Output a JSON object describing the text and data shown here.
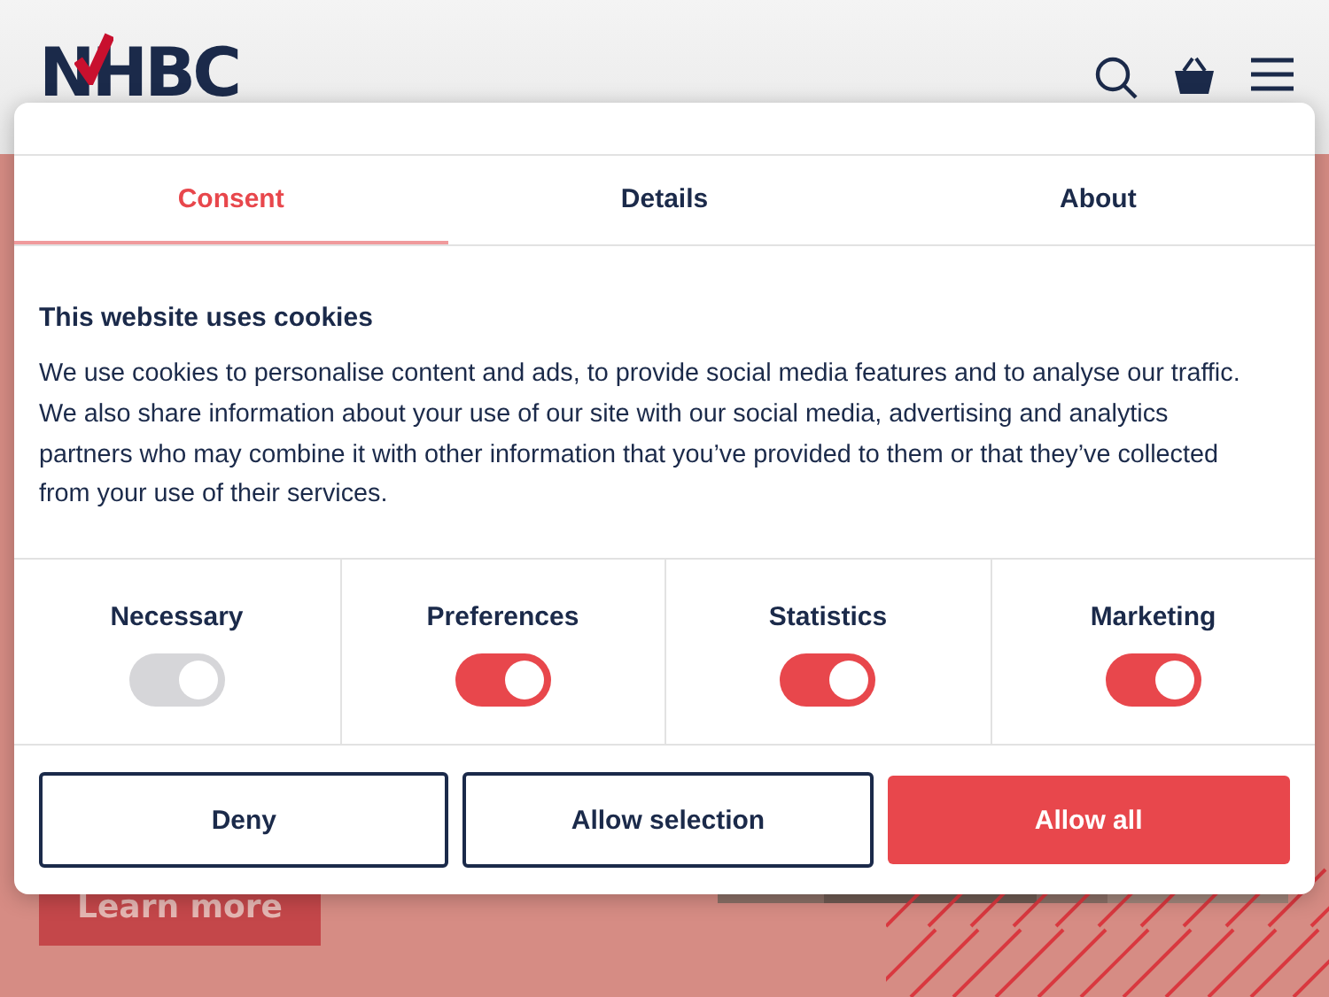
{
  "header": {
    "logo": "NHBC"
  },
  "hero": {
    "button": "Learn more"
  },
  "dialog": {
    "tabs": [
      {
        "label": "Consent",
        "selected": true
      },
      {
        "label": "Details",
        "selected": false
      },
      {
        "label": "About",
        "selected": false
      }
    ],
    "title": "This website uses cookies",
    "body": "We use cookies to personalise content and ads, to provide social media features and to analyse our traffic. We also share information about your use of our site with our social media, advertising and analytics partners who may combine it with other information that you’ve provided to them or that they’ve collected from your use of their services.",
    "categories": [
      {
        "label": "Necessary",
        "on": true,
        "disabled": true
      },
      {
        "label": "Preferences",
        "on": true,
        "disabled": false
      },
      {
        "label": "Statistics",
        "on": true,
        "disabled": false
      },
      {
        "label": "Marketing",
        "on": true,
        "disabled": false
      }
    ],
    "buttons": [
      {
        "label": "Deny",
        "kind": "outline"
      },
      {
        "label": "Allow selection",
        "kind": "outline"
      },
      {
        "label": "Allow all",
        "kind": "primary"
      }
    ]
  }
}
